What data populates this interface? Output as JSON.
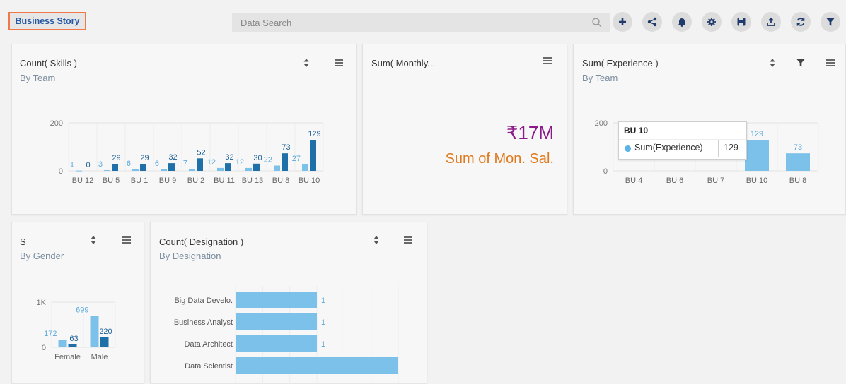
{
  "toolbar": {
    "story_tab": "Business Story",
    "search_placeholder": "Data Search",
    "buttons": [
      "add",
      "share",
      "alert",
      "settings",
      "save",
      "export",
      "refresh",
      "filter"
    ]
  },
  "colors": {
    "bar_light": "#7cc1ea",
    "bar_dark": "#1f6fa8",
    "label_light": "#5aa9dc",
    "label_dark": "#1b5f96",
    "kpi_value": "#8b1a8b",
    "kpi_label": "#e07a1e",
    "accent": "#2458a4"
  },
  "cards": {
    "skills": {
      "title": "Count( Skills )",
      "subtitle": "By Team"
    },
    "monthly": {
      "title": "Sum( Monthly...",
      "value": "₹17M",
      "label": "Sum of Mon. Sal."
    },
    "experience": {
      "title": "Sum( Experience )",
      "subtitle": "By Team",
      "tooltip": {
        "title": "BU 10",
        "series": "Sum(Experience)",
        "value": "129"
      }
    },
    "gender": {
      "title": "S",
      "subtitle": "By Gender"
    },
    "designation": {
      "title": "Count( Designation )",
      "subtitle": "By Designation"
    }
  },
  "chart_data": [
    {
      "type": "bar",
      "id": "skills",
      "categories": [
        "BU 12",
        "BU 5",
        "BU 1",
        "BU 9",
        "BU 2",
        "BU 11",
        "BU 13",
        "BU 8",
        "BU 10"
      ],
      "series": [
        {
          "values": [
            1,
            3,
            6,
            6,
            7,
            12,
            12,
            22,
            27
          ]
        },
        {
          "values": [
            0,
            29,
            29,
            32,
            52,
            32,
            30,
            73,
            129
          ]
        }
      ],
      "ylim": [
        0,
        200
      ],
      "yticks": [
        "0",
        "200"
      ]
    },
    {
      "type": "bar",
      "id": "experience",
      "categories": [
        "BU 4",
        "BU 6",
        "BU 7",
        "BU 10",
        "BU 8"
      ],
      "series": [
        {
          "name": "Sum(Experience)",
          "values": [
            null,
            null,
            null,
            129,
            73
          ]
        }
      ],
      "ylim": [
        0,
        200
      ],
      "yticks": [
        "0",
        "200"
      ]
    },
    {
      "type": "bar",
      "id": "gender",
      "categories": [
        "Female",
        "Male"
      ],
      "series": [
        {
          "values": [
            172,
            699
          ]
        },
        {
          "values": [
            63,
            220
          ]
        }
      ],
      "ylim": [
        0,
        1000
      ],
      "yticks": [
        "0",
        "1K"
      ]
    },
    {
      "type": "bar",
      "orientation": "horizontal",
      "id": "designation",
      "categories": [
        "Big Data Develo.",
        "Business Analyst",
        "Data Architect",
        "Data Scientist"
      ],
      "values": [
        1,
        1,
        1,
        null
      ],
      "labels": [
        "1",
        "1",
        "1",
        ""
      ]
    }
  ]
}
